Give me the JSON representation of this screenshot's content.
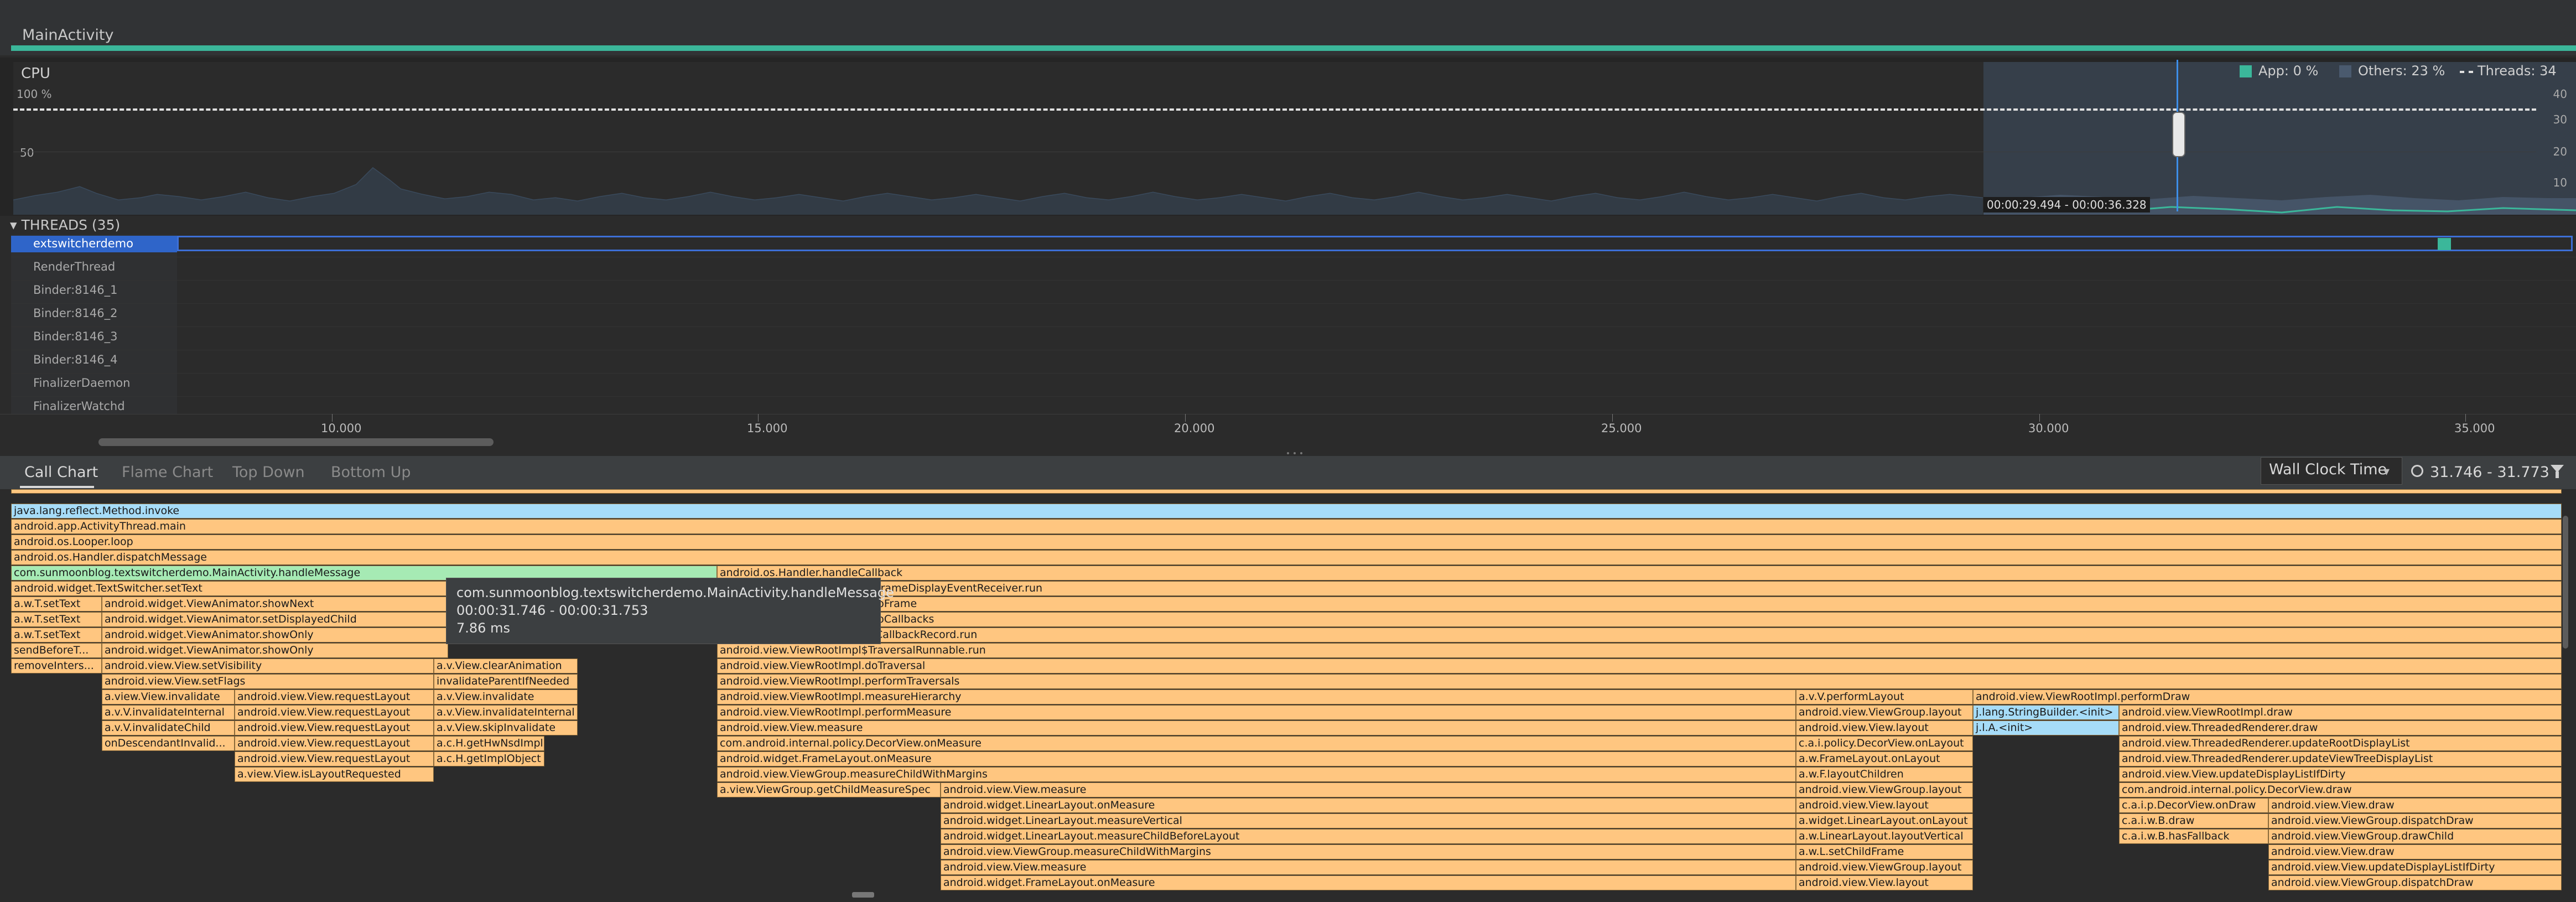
{
  "session": {
    "title": "MainActivity"
  },
  "cpu": {
    "title": "CPU",
    "y_labels": [
      "100 %",
      "50"
    ],
    "right_labels": [
      "40",
      "30",
      "20",
      "10"
    ],
    "legend": [
      {
        "label": "App: 0 %",
        "color": "#3bb79a",
        "shape": "square"
      },
      {
        "label": "Others: 23 %",
        "color": "#4a5a6e",
        "shape": "square"
      },
      {
        "label": "Threads: 34",
        "color": "#e0e0e0",
        "shape": "dash"
      }
    ],
    "selection_range": "00:00:29.494 - 00:00:36.328"
  },
  "threads": {
    "header": "THREADS (35)",
    "items": [
      "extswitcherdemo",
      "RenderThread",
      "Binder:8146_1",
      "Binder:8146_2",
      "Binder:8146_3",
      "Binder:8146_4",
      "FinalizerDaemon",
      "FinalizerWatchd"
    ]
  },
  "axis": {
    "ticks": [
      "10.000",
      "15.000",
      "20.000",
      "25.000",
      "30.000",
      "35.000"
    ]
  },
  "tabs": [
    "Call Chart",
    "Flame Chart",
    "Top Down",
    "Bottom Up"
  ],
  "toolbar": {
    "clock_mode": "Wall Clock Time",
    "range": "31.746 - 31.773"
  },
  "tooltip": {
    "method": "com.sunmoonblog.textswitcherdemo.MainActivity.handleMessage",
    "range": "00:00:31.746 - 00:00:31.753",
    "duration": "7.86 ms"
  },
  "call_chart": {
    "rows": [
      [
        "java.lang.reflect.Method.invoke"
      ],
      [
        "android.app.ActivityThread.main"
      ],
      [
        "android.os.Looper.loop"
      ],
      [
        "android.os.Handler.dispatchMessage"
      ],
      [
        "com.sunmoonblog.textswitcherdemo.MainActivity.handleMessage",
        "android.os.Handler.handleCallback"
      ],
      [
        "android.widget.TextSwitcher.setText",
        "android.view.Choreographer$FrameDisplayEventReceiver.run"
      ],
      [
        "a.w.T.setText",
        "android.widget.ViewAnimator.showNext",
        "android.view.Choreographer.doFrame"
      ],
      [
        "a.w.T.setText",
        "android.widget.ViewAnimator.setDisplayedChild",
        "android.view.Choreographer.doCallbacks"
      ],
      [
        "a.w.T.setText",
        "android.widget.ViewAnimator.showOnly",
        "android.view.Choreographer$CallbackRecord.run"
      ],
      [
        "sendBeforeT...",
        "android.widget.ViewAnimator.showOnly",
        "android.view.ViewRootImpl$TraversalRunnable.run"
      ],
      [
        "removeInters...",
        "android.view.View.setVisibility",
        "a.v.View.clearAnimation",
        "android.view.ViewRootImpl.doTraversal"
      ],
      [
        "android.view.View.setFlags",
        "invalidateParentIfNeeded",
        "android.view.ViewRootImpl.performTraversals"
      ],
      [
        "a.view.View.invalidate",
        "android.view.View.requestLayout",
        "a.v.View.invalidate",
        "android.view.ViewRootImpl.measureHierarchy",
        "a.v.V.performLayout",
        "android.view.ViewRootImpl.performDraw"
      ],
      [
        "a.v.V.invalidateInternal",
        "android.view.View.requestLayout",
        "a.v.View.invalidateInternal",
        "android.view.ViewRootImpl.performMeasure",
        "android.view.ViewGroup.layout",
        "j.lang.StringBuilder.<init>",
        "android.view.ViewRootImpl.draw"
      ],
      [
        "a.v.V.invalidateChild",
        "android.view.View.requestLayout",
        "a.v.View.skipInvalidate",
        "android.view.View.measure",
        "android.view.View.layout",
        "j.l.A.<init>",
        "android.view.ThreadedRenderer.draw"
      ],
      [
        "onDescendantInvalid...",
        "android.view.View.requestLayout",
        "a.c.H.getHwNsdImpl",
        "com.android.internal.policy.DecorView.onMeasure",
        "c.a.i.policy.DecorView.onLayout",
        "android.view.ThreadedRenderer.updateRootDisplayList"
      ],
      [
        "android.view.View.requestLayout",
        "a.c.H.getImplObject",
        "android.widget.FrameLayout.onMeasure",
        "a.w.FrameLayout.onLayout",
        "android.view.ThreadedRenderer.updateViewTreeDisplayList"
      ],
      [
        "a.view.View.isLayoutRequested",
        "android.view.ViewGroup.measureChildWithMargins",
        "a.w.F.layoutChildren",
        "android.view.View.updateDisplayListIfDirty"
      ],
      [
        "a.view.ViewGroup.getChildMeasureSpec",
        "android.view.View.measure",
        "android.view.ViewGroup.layout",
        "com.android.internal.policy.DecorView.draw"
      ],
      [
        "android.widget.LinearLayout.onMeasure",
        "android.view.View.layout",
        "c.a.i.p.DecorView.onDraw",
        "android.view.View.draw"
      ],
      [
        "android.widget.LinearLayout.measureVertical",
        "a.widget.LinearLayout.onLayout",
        "c.a.i.w.B.draw",
        "android.view.ViewGroup.dispatchDraw"
      ],
      [
        "android.widget.LinearLayout.measureChildBeforeLayout",
        "a.w.LinearLayout.layoutVertical",
        "c.a.i.w.B.hasFallback",
        "android.view.ViewGroup.drawChild"
      ],
      [
        "android.view.ViewGroup.measureChildWithMargins",
        "a.w.L.setChildFrame",
        "android.view.View.draw"
      ],
      [
        "android.view.View.measure",
        "android.view.ViewGroup.layout",
        "android.view.View.updateDisplayListIfDirty"
      ],
      [
        "android.widget.FrameLayout.onMeasure",
        "android.view.View.layout",
        "android.view.ViewGroup.dispatchDraw"
      ]
    ]
  }
}
